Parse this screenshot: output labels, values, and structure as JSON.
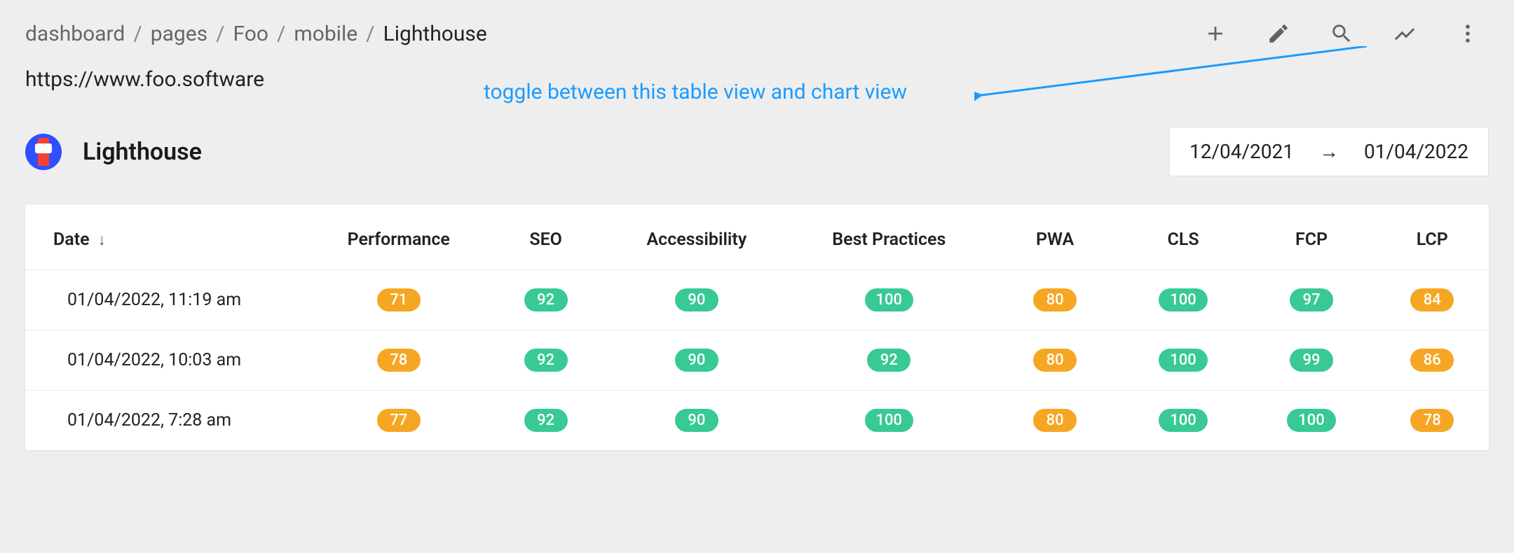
{
  "breadcrumbs": [
    {
      "label": "dashboard",
      "current": false
    },
    {
      "label": "pages",
      "current": false
    },
    {
      "label": "Foo",
      "current": false
    },
    {
      "label": "mobile",
      "current": false
    },
    {
      "label": "Lighthouse",
      "current": true
    }
  ],
  "url": "https://www.foo.software",
  "annotation": "toggle between this table view and chart view",
  "heading": "Lighthouse",
  "date_range": {
    "start": "12/04/2021",
    "end": "01/04/2022"
  },
  "columns": [
    {
      "key": "date",
      "label": "Date",
      "sortable": true,
      "align": "left"
    },
    {
      "key": "performance",
      "label": "Performance",
      "align": "center"
    },
    {
      "key": "seo",
      "label": "SEO",
      "align": "center"
    },
    {
      "key": "accessibility",
      "label": "Accessibility",
      "align": "center"
    },
    {
      "key": "best_practices",
      "label": "Best Practices",
      "align": "center"
    },
    {
      "key": "pwa",
      "label": "PWA",
      "align": "center"
    },
    {
      "key": "cls",
      "label": "CLS",
      "align": "center"
    },
    {
      "key": "fcp",
      "label": "FCP",
      "align": "center"
    },
    {
      "key": "lcp",
      "label": "LCP",
      "align": "center"
    }
  ],
  "rows": [
    {
      "date": "01/04/2022, 11:19 am",
      "cells": [
        {
          "value": 71,
          "color": "orange"
        },
        {
          "value": 92,
          "color": "green"
        },
        {
          "value": 90,
          "color": "green"
        },
        {
          "value": 100,
          "color": "green"
        },
        {
          "value": 80,
          "color": "orange"
        },
        {
          "value": 100,
          "color": "green"
        },
        {
          "value": 97,
          "color": "green"
        },
        {
          "value": 84,
          "color": "orange"
        }
      ]
    },
    {
      "date": "01/04/2022, 10:03 am",
      "cells": [
        {
          "value": 78,
          "color": "orange"
        },
        {
          "value": 92,
          "color": "green"
        },
        {
          "value": 90,
          "color": "green"
        },
        {
          "value": 92,
          "color": "green"
        },
        {
          "value": 80,
          "color": "orange"
        },
        {
          "value": 100,
          "color": "green"
        },
        {
          "value": 99,
          "color": "green"
        },
        {
          "value": 86,
          "color": "orange"
        }
      ]
    },
    {
      "date": "01/04/2022, 7:28 am",
      "cells": [
        {
          "value": 77,
          "color": "orange"
        },
        {
          "value": 92,
          "color": "green"
        },
        {
          "value": 90,
          "color": "green"
        },
        {
          "value": 100,
          "color": "green"
        },
        {
          "value": 80,
          "color": "orange"
        },
        {
          "value": 100,
          "color": "green"
        },
        {
          "value": 100,
          "color": "green"
        },
        {
          "value": 78,
          "color": "orange"
        }
      ]
    }
  ],
  "colors": {
    "green": "#38c995",
    "orange": "#f5a623",
    "red": "#e53935",
    "accent": "#1a9bff"
  }
}
